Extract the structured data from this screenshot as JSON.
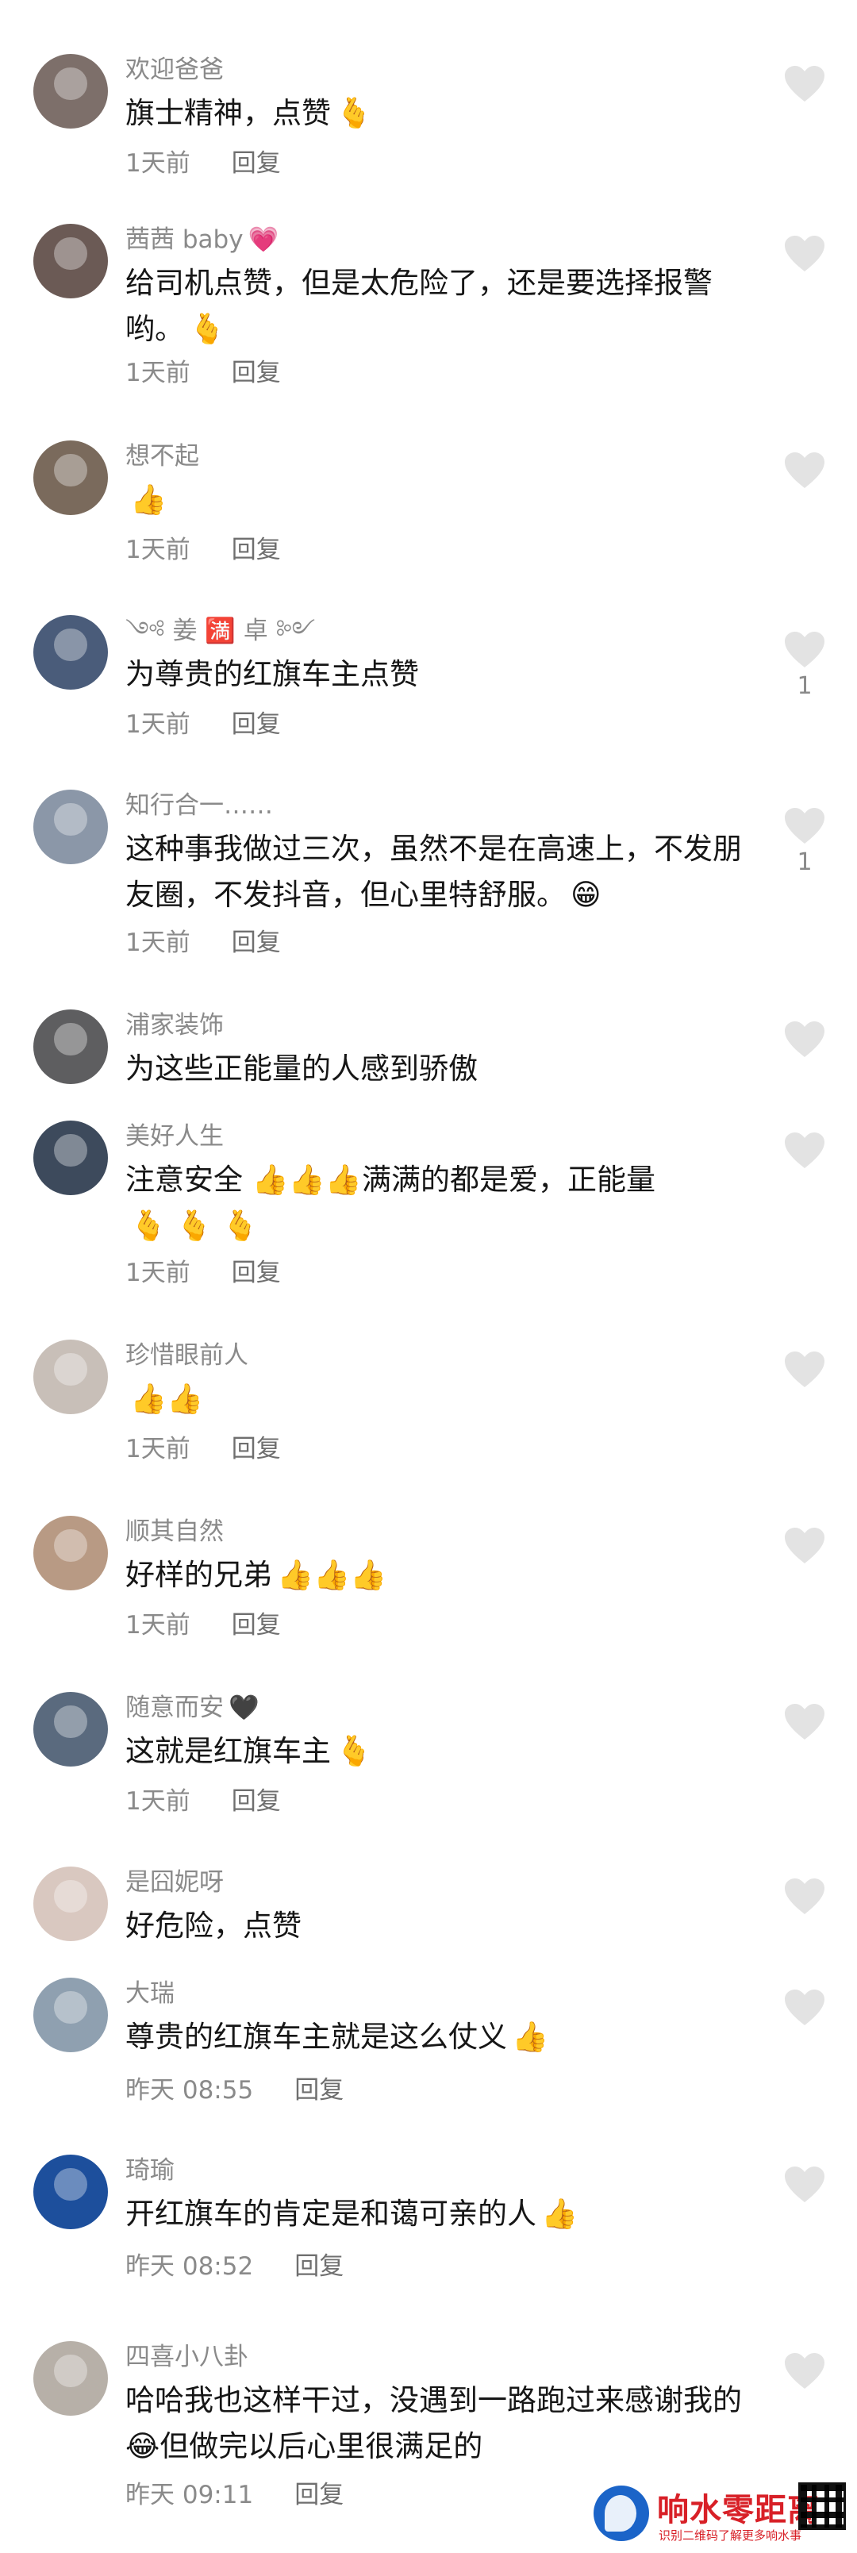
{
  "colors": {
    "username": "#8a8a8a",
    "text": "#161616",
    "meta": "#8a8a8a",
    "like_icon": "#e3e3e3",
    "watermark": "#d82027"
  },
  "reply_label": "回复",
  "comments": [
    {
      "username": "欢迎爸爸",
      "text": "旗士精神，点赞",
      "emoji": "🫰",
      "time": "1天前",
      "likes": "",
      "avatar_color": "#7d6f6a"
    },
    {
      "username": "茜茜 baby",
      "username_emoji": "💗",
      "text": "给司机点赞，但是太危险了，还是要选择报警哟。",
      "emoji": "🫰",
      "time": "1天前",
      "likes": "",
      "avatar_color": "#6b5a55"
    },
    {
      "username": "想不起",
      "text": "",
      "emoji": "👍",
      "time": "1天前",
      "likes": "",
      "avatar_color": "#7a6a5c"
    },
    {
      "username": "༺ 姜 🈵 卓 ༻",
      "text": "为尊贵的红旗车主点赞",
      "emoji": "",
      "time": "1天前",
      "likes": "1",
      "avatar_color": "#4a5c7a"
    },
    {
      "username": "知行合一……",
      "text": "这种事我做过三次，虽然不是在高速上，不发朋友圈，不发抖音，但心里特舒服。",
      "emoji": "😁",
      "time": "1天前",
      "likes": "1",
      "avatar_color": "#8b97a8"
    },
    {
      "username": "浦家装饰",
      "text": "为这些正能量的人感到骄傲",
      "emoji": "",
      "time": "",
      "likes": "",
      "avatar_color": "#5e5e60"
    },
    {
      "username": "美好人生",
      "text": "注意安全 👍👍👍满满的都是爱，正能量",
      "emoji": "🫰 🫰 🫰",
      "time": "1天前",
      "likes": "",
      "avatar_color": "#3d4a5c"
    },
    {
      "username": "珍惜眼前人",
      "text": "",
      "emoji": "👍👍",
      "time": "1天前",
      "likes": "",
      "avatar_color": "#c8bfb8"
    },
    {
      "username": "顺其自然",
      "text": "好样的兄弟",
      "emoji": "👍👍👍",
      "time": "1天前",
      "likes": "",
      "avatar_color": "#b89a84"
    },
    {
      "username": "随意而安",
      "username_emoji": "🖤",
      "text": "这就是红旗车主",
      "emoji": "🫰",
      "time": "1天前",
      "likes": "",
      "avatar_color": "#5a6a7e"
    },
    {
      "username": "是囧妮呀",
      "text": "好危险，点赞",
      "emoji": "",
      "time": "",
      "likes": "",
      "avatar_color": "#d9c8c0"
    },
    {
      "username": "大瑞",
      "text": "尊贵的红旗车主就是这么仗义",
      "emoji": "👍",
      "time": "昨天 08:55",
      "likes": "",
      "avatar_color": "#8fa0b0"
    },
    {
      "username": "琦瑜",
      "text": "开红旗车的肯定是和蔼可亲的人",
      "emoji": "👍",
      "time": "昨天 08:52",
      "likes": "",
      "avatar_color": "#1d4f9c"
    },
    {
      "username": "四喜小八卦",
      "text": "哈哈我也这样干过，没遇到一路跑过来感谢我的😂但做完以后心里很满足的",
      "emoji": "",
      "time": "昨天 09:11",
      "likes": "",
      "avatar_color": "#b7b0a8"
    }
  ],
  "watermark": {
    "title": "响水零距离",
    "subtitle": "识别二维码了解更多响水事"
  }
}
